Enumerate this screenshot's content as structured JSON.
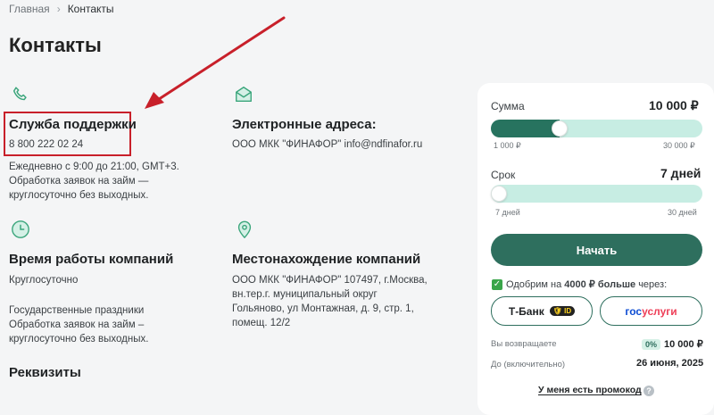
{
  "breadcrumb": {
    "home": "Главная",
    "separator": "›",
    "current": "Контакты"
  },
  "page_title": "Контакты",
  "support": {
    "title": "Служба поддержки",
    "phone": "8 800 222 02 24",
    "hours": "Ежедневно с 9:00 до 21:00, GMT+3.",
    "note_1": "Обработка заявок на займ —",
    "note_2": "круглосуточно без выходных."
  },
  "email": {
    "title": "Электронные адреса:",
    "line": "ООО МКК \"ФИНАФОР\" info@ndfinafor.ru"
  },
  "hours": {
    "title": "Время работы компаний",
    "value": "Круглосуточно",
    "holidays": "Государственные праздники",
    "note_1": "Обработка заявок на займ –",
    "note_2": "круглосуточно без выходных."
  },
  "location": {
    "title": "Местонахождение компаний",
    "lines": [
      "ООО МКК \"ФИНАФОР\" 107497, г.Москва,",
      "вн.тер.г. муниципальный округ",
      "Гольяново, ул Монтажная, д. 9, стр. 1,",
      "помещ. 12/2"
    ]
  },
  "requisites_title": "Реквизиты",
  "calculator": {
    "amount_label": "Сумма",
    "amount_value": "10 000 ₽",
    "amount_min": "1 000 ₽",
    "amount_max": "30 000 ₽",
    "amount_fill_fraction": 0.31,
    "term_label": "Срок",
    "term_value": "7 дней",
    "term_min": "7 дней",
    "term_max": "30 дней",
    "term_fill_fraction": 0.0,
    "submit": "Начать",
    "approve_prefix": "Одобрим на ",
    "approve_bold": "4000 ₽ больше",
    "approve_suffix": " через:",
    "tbank_label": "Т-Банк",
    "tbank_badge": "ID",
    "gos_part1": "гос",
    "gos_part2": "услуги",
    "return_label": "Вы возвращаете",
    "rate": "0%",
    "return_value": "10 000 ₽",
    "until_label": "До (включительно)",
    "until_value": "26 июня, 2025",
    "promo": "У меня есть промокод",
    "promo_help": "?"
  },
  "colors": {
    "accent": "#2e6f5e",
    "track": "#c7ede3",
    "highlight": "#c8202a",
    "icon": "#3aa57b"
  }
}
